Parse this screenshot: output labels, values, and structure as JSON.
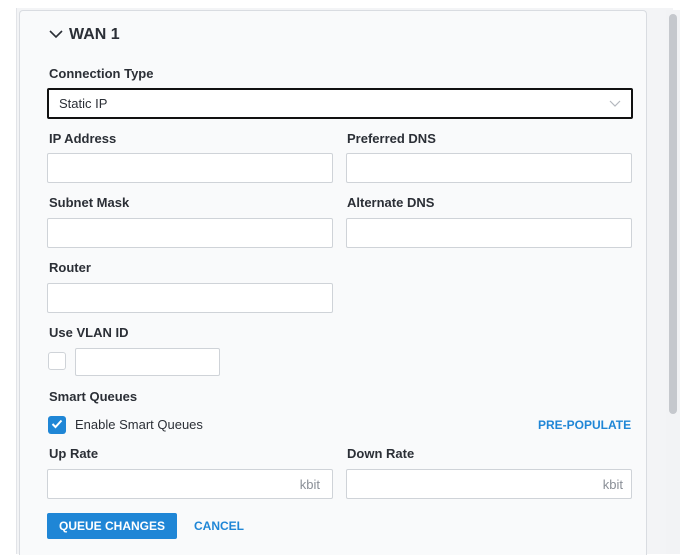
{
  "section": {
    "title": "WAN 1",
    "icon": "chevron-down-icon"
  },
  "connection_type": {
    "label": "Connection Type",
    "value": "Static IP",
    "icon": "chevron-down-icon"
  },
  "ip_address": {
    "label": "IP Address",
    "value": ""
  },
  "preferred_dns": {
    "label": "Preferred DNS",
    "value": ""
  },
  "subnet_mask": {
    "label": "Subnet Mask",
    "value": ""
  },
  "alternate_dns": {
    "label": "Alternate DNS",
    "value": ""
  },
  "router": {
    "label": "Router",
    "value": ""
  },
  "vlan": {
    "label": "Use VLAN ID",
    "checked": false,
    "value": ""
  },
  "smart_queues": {
    "label": "Smart Queues",
    "checkbox_label": "Enable Smart Queues",
    "checked": true,
    "prepopulate_label": "PRE-POPULATE"
  },
  "up_rate": {
    "label": "Up Rate",
    "value": "",
    "unit": "kbit"
  },
  "down_rate": {
    "label": "Down Rate",
    "value": "",
    "unit": "kbit"
  },
  "actions": {
    "queue_label": "QUEUE CHANGES",
    "cancel_label": "CANCEL"
  },
  "colors": {
    "accent": "#1f86d6",
    "panel_bg": "#f9fafb",
    "border": "#cfd3d8"
  }
}
